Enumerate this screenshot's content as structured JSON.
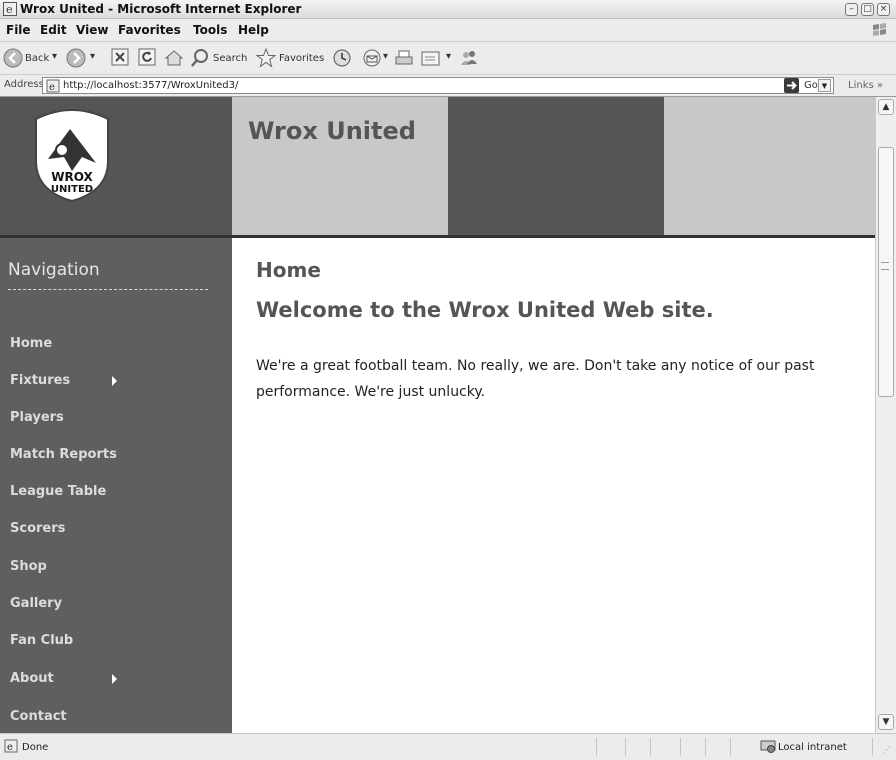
{
  "window": {
    "title": "Wrox United - Microsoft Internet Explorer",
    "controls": [
      "minimize",
      "maximize",
      "close"
    ]
  },
  "menu": [
    "File",
    "Edit",
    "View",
    "Favorites",
    "Tools",
    "Help"
  ],
  "toolbar": {
    "back_label": "Back",
    "search_label": "Search",
    "favorites_label": "Favorites"
  },
  "address": {
    "label": "Address",
    "url": "http://localhost:3577/WroxUnited3/",
    "go_label": "Go",
    "links_label": "Links"
  },
  "site": {
    "logo_text": "WROX UNITED",
    "title": "Wrox United"
  },
  "nav": {
    "title": "Navigation",
    "items": [
      {
        "label": "Home",
        "has_submenu": false
      },
      {
        "label": "Fixtures",
        "has_submenu": true
      },
      {
        "label": "Players",
        "has_submenu": false
      },
      {
        "label": "Match Reports",
        "has_submenu": false
      },
      {
        "label": "League Table",
        "has_submenu": false
      },
      {
        "label": "Scorers",
        "has_submenu": false
      },
      {
        "label": "Shop",
        "has_submenu": false
      },
      {
        "label": "Gallery",
        "has_submenu": false
      },
      {
        "label": "Fan Club",
        "has_submenu": false
      },
      {
        "label": "About",
        "has_submenu": true
      },
      {
        "label": "Contact",
        "has_submenu": false
      }
    ]
  },
  "content": {
    "page_heading": "Home",
    "welcome_heading": "Welcome to the Wrox United Web site.",
    "intro": "We're a great football team. No really, we are. Don't take any notice of our past performance. We're just unlucky."
  },
  "status": {
    "text": "Done",
    "zone": "Local intranet"
  },
  "colors": {
    "dark_panel": "#555555",
    "light_panel": "#c8c8c8",
    "sidebar": "#5f5f5f",
    "heading_text": "#555555"
  }
}
